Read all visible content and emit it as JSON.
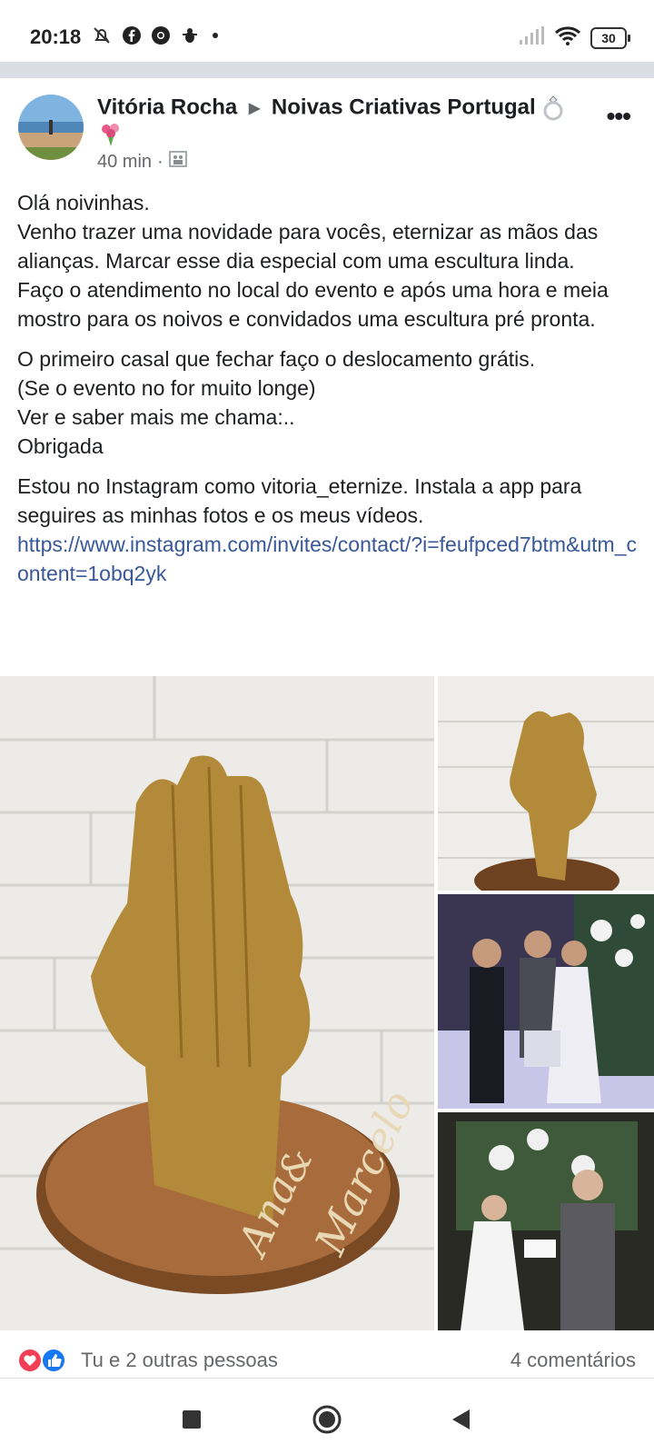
{
  "status_bar": {
    "time": "20:18",
    "left_icons": [
      "alarm-off-icon",
      "facebook-icon",
      "chrome-icon",
      "bug-icon",
      "dot-icon"
    ],
    "right_icons": [
      "signal-icon",
      "wifi-icon"
    ],
    "battery": "30"
  },
  "post": {
    "author": "Vitória Rocha",
    "group": "Noivas Criativas Portugal",
    "time": "40 min",
    "privacy_icon": "group-icon",
    "paragraphs": [
      [
        "Olá noivinhas.",
        "Venho trazer uma novidade para vocês, eternizar as mãos das alianças. Marcar esse dia especial com uma escultura linda.",
        "Faço o atendimento no local do evento e após uma hora e meia mostro para os noivos e convidados uma escultura pré pronta."
      ],
      [
        "O primeiro casal que fechar faço o deslocamento grátis.",
        "(Se o evento no for muito longe)",
        "Ver e saber mais me chama:..",
        "Obrigada"
      ],
      [
        "Estou no Instagram como vitoria_eternize. Instala a app para seguires as minhas fotos e os meus vídeos."
      ]
    ],
    "link": "https://www.instagram.com/invites/contact/?i=feufpced7btm&utm_content=1obq2yk",
    "photos": {
      "main_engraving": [
        "Ana",
        "&",
        "Marcelo"
      ]
    }
  },
  "reactions": {
    "icons": [
      "love-reaction-icon",
      "like-reaction-icon"
    ],
    "text": "Tu e 2 outras pessoas",
    "comments": "4 comentários"
  },
  "nav": {
    "icons": [
      "recents-square-icon",
      "home-circle-icon",
      "back-triangle-icon"
    ]
  }
}
